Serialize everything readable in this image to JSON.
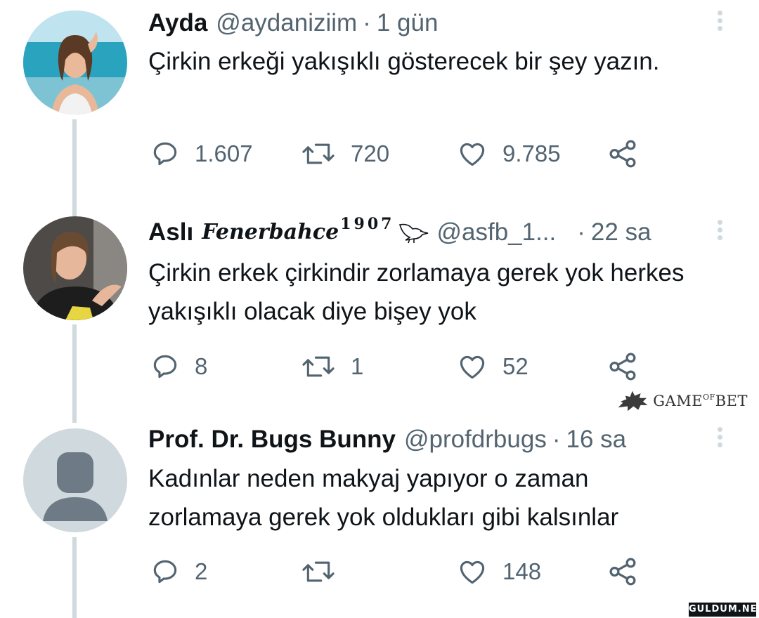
{
  "tweets": [
    {
      "name": "Ayda",
      "handle": "@aydaniziim",
      "time": "1 gün",
      "text": "Çirkin erkeği yakışıklı gösterecek bir şey yazın.",
      "replies": "1.607",
      "retweets": "720",
      "likes": "9.785"
    },
    {
      "name": "Aslı",
      "name_fancy": "Fenerbahce",
      "name_sup": "1907",
      "handle": "@asfb_1...",
      "time": "22 sa",
      "text": "Çirkin erkek çirkindir zorlamaya gerek yok herkes yakışıklı olacak diye bişey yok",
      "replies": "8",
      "retweets": "1",
      "likes": "52"
    },
    {
      "name": "Prof. Dr. Bugs Bunny",
      "handle": "@profdrbugs",
      "time": "16 sa",
      "text": "Kadınlar neden makyaj yapıyor o zaman zorlamaya gerek yok oldukları gibi kalsınlar",
      "replies": "2",
      "retweets": "",
      "likes": "148"
    }
  ],
  "separator": "·",
  "watermarks": {
    "gameofbet": "GAMEOFBET",
    "gameofbet_a": "GAME",
    "gameofbet_b": "OF",
    "gameofbet_c": "BET",
    "site": "GULDUM.NET"
  },
  "colors": {
    "text": "#0f1419",
    "secondary": "#536471",
    "thread_line": "#cfd9de"
  },
  "icons": [
    "reply-icon",
    "retweet-icon",
    "like-icon",
    "share-icon",
    "more-icon",
    "bird-icon",
    "wolf-icon"
  ]
}
